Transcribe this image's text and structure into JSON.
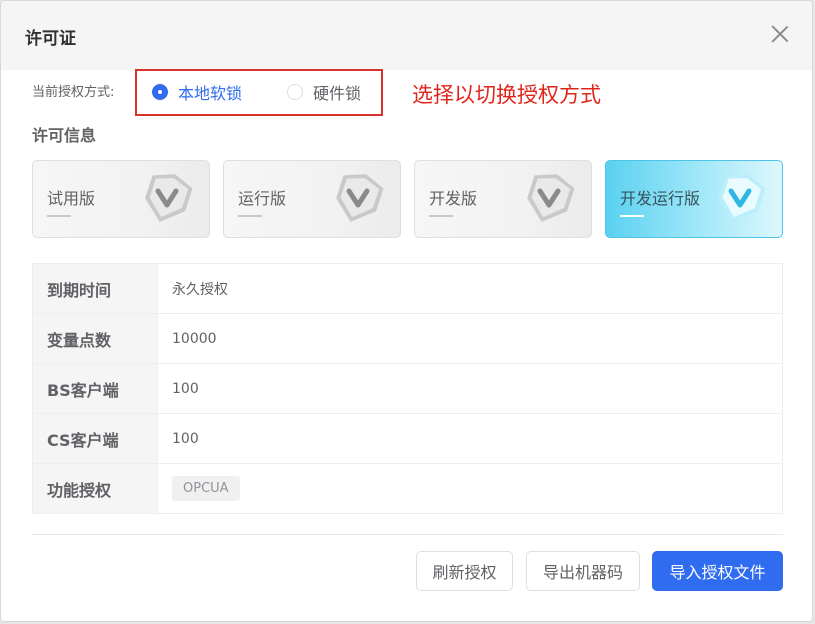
{
  "dialog": {
    "title": "许可证"
  },
  "mode": {
    "label": "当前授权方式:",
    "options": [
      {
        "label": "本地软锁",
        "checked": true
      },
      {
        "label": "硬件锁",
        "checked": false
      }
    ],
    "annotation": "选择以切换授权方式",
    "accent_color": "#2f6cf0",
    "annotation_color": "#e0251b"
  },
  "section": {
    "title": "许可信息"
  },
  "cards": [
    {
      "title": "试用版",
      "icon": "v-badge-icon",
      "active": false
    },
    {
      "title": "运行版",
      "icon": "v-badge-icon",
      "active": false
    },
    {
      "title": "开发版",
      "icon": "v-badge-icon",
      "active": false
    },
    {
      "title": "开发运行版",
      "icon": "v-badge-icon",
      "active": true
    }
  ],
  "info": {
    "rows": [
      {
        "key": "到期时间",
        "value": "永久授权"
      },
      {
        "key": "变量点数",
        "value": "10000"
      },
      {
        "key": "BS客户端",
        "value": "100"
      },
      {
        "key": "CS客户端",
        "value": "100"
      },
      {
        "key": "功能授权",
        "value": "OPCUA"
      }
    ]
  },
  "footer": {
    "refresh": "刷新授权",
    "export": "导出机器码",
    "import": "导入授权文件"
  }
}
